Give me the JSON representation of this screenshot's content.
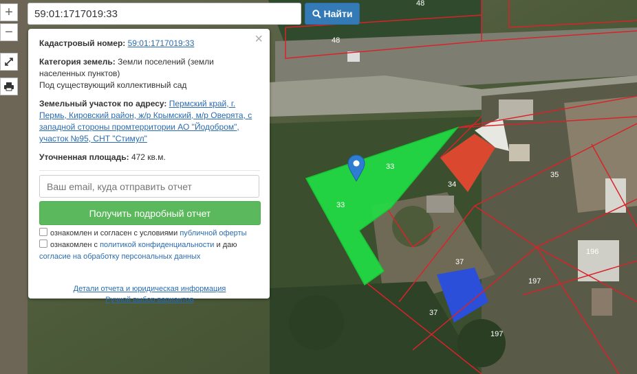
{
  "search": {
    "value": "59:01:1717019:33",
    "button_label": "Найти"
  },
  "zoom": {
    "plus": "+",
    "minus": "−"
  },
  "panel": {
    "cadastral_label": "Кадастровый номер:",
    "cadastral_value": "59:01:1717019:33",
    "category_label": "Категория земель:",
    "category_value": "Земли поселений (земли населенных пунктов)",
    "use_value": "Под существующий коллективный сад",
    "address_label": "Земельный участок по адресу:",
    "address_value": "Пермский край, г. Пермь, Кировский район, ж/р Крымский, м/р Оверята, с западной стороны промтерритории АО \"Йодобром\", участок №95, СНТ \"Стимул\"",
    "area_label": "Уточненная площадь:",
    "area_value": "472 кв.м.",
    "email_placeholder": "Ваш email, куда отправить отчет",
    "report_button": "Получить подробный отчет",
    "consent1_pre": "ознакомлен и согласен с условиями",
    "consent1_link": "публичной оферты",
    "consent2_pre": "ознакомлен с",
    "consent2_link": "политикой конфиденциальности",
    "consent2_mid": "и даю",
    "consent2_link2": "согласие на обработку персональных данных",
    "link_details": "Детали отчета и юридическая информация",
    "link_manual": "Ручной выбор вариантов"
  },
  "map_labels": {
    "l48a": "48",
    "l48b": "48",
    "l33a": "33",
    "l33b": "33",
    "l34": "34",
    "l35": "35",
    "l37a": "37",
    "l37b": "37",
    "l196": "196",
    "l197a": "197",
    "l197b": "197"
  },
  "colors": {
    "selected_plot": "#22dd44",
    "boundary": "#d8232a",
    "primary": "#337ab7",
    "success": "#5cb85c"
  }
}
